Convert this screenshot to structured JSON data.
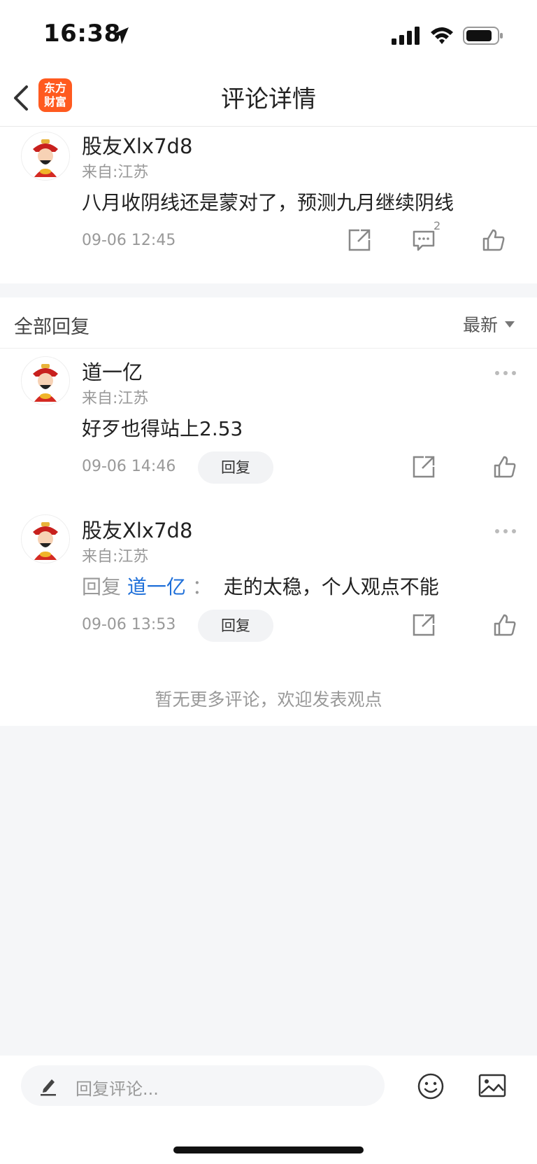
{
  "status_bar": {
    "time": "16:38"
  },
  "nav": {
    "logo_line1": "东方",
    "logo_line2": "财富",
    "title": "评论详情"
  },
  "main_comment": {
    "username": "股友Xlx7d8",
    "origin": "来自:江苏",
    "content": "八月收阴线还是蒙对了，预测九月继续阴线",
    "time": "09-06 12:45",
    "reply_count": "2"
  },
  "replies": {
    "title": "全部回复",
    "sort_label": "最新",
    "items": [
      {
        "username": "道一亿",
        "origin": "来自:江苏",
        "content": "好歹也得站上2.53",
        "time": "09-06 14:46",
        "reply_label": "回复"
      },
      {
        "username": "股友Xlx7d8",
        "origin": "来自:江苏",
        "reply_prefix": "回复",
        "mention": "道一亿",
        "colon": "：",
        "content": "走的太稳，个人观点不能",
        "time": "09-06 13:53",
        "reply_label": "回复"
      }
    ],
    "no_more": "暂无更多评论，欢迎发表观点"
  },
  "bottom_bar": {
    "placeholder": "回复评论..."
  },
  "icons": {
    "share": "share-icon",
    "comment": "comment-icon",
    "like": "thumbs-up-icon",
    "more": "more-dots-icon",
    "emoji": "emoji-icon",
    "image": "image-icon",
    "pencil": "pencil-icon"
  },
  "colors": {
    "accent": "#1e6fd9",
    "logo": "#ff5a1f"
  }
}
